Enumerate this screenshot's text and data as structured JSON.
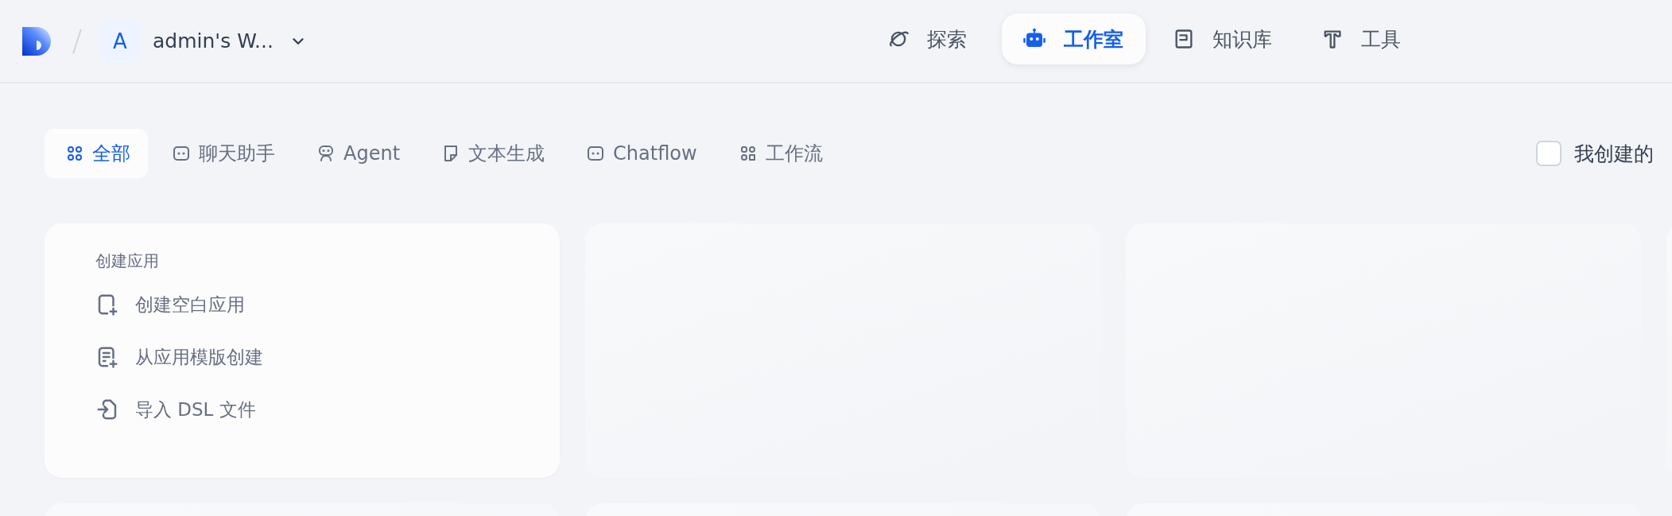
{
  "header": {
    "workspace": {
      "avatar": "A",
      "name": "admin's W..."
    },
    "nav": [
      {
        "label": "探索",
        "kind": "explore",
        "selected": false
      },
      {
        "label": "工作室",
        "kind": "studio",
        "selected": true
      },
      {
        "label": "知识库",
        "kind": "knowledge",
        "selected": false
      },
      {
        "label": "工具",
        "kind": "tools",
        "selected": false
      }
    ]
  },
  "filters": {
    "tabs": [
      {
        "label": "全部",
        "kind": "all",
        "selected": true
      },
      {
        "label": "聊天助手",
        "kind": "chat",
        "selected": false
      },
      {
        "label": "Agent",
        "kind": "agent",
        "selected": false
      },
      {
        "label": "文本生成",
        "kind": "completion",
        "selected": false
      },
      {
        "label": "Chatflow",
        "kind": "chat",
        "selected": false
      },
      {
        "label": "工作流",
        "kind": "workflow",
        "selected": false
      }
    ],
    "created_by_me": {
      "label": "我创建的",
      "checked": false
    }
  },
  "create_card": {
    "title": "创建应用",
    "actions": [
      {
        "label": "创建空白应用",
        "kind": "blank"
      },
      {
        "label": "从应用模版创建",
        "kind": "template"
      },
      {
        "label": "导入 DSL 文件",
        "kind": "import"
      }
    ]
  },
  "app_cards": [
    {
      "kind": "placeholder"
    },
    {
      "kind": "placeholder"
    },
    {
      "kind": "placeholder"
    },
    {
      "kind": "placeholder"
    },
    {
      "kind": "placeholder"
    },
    {
      "kind": "placeholder"
    }
  ]
}
